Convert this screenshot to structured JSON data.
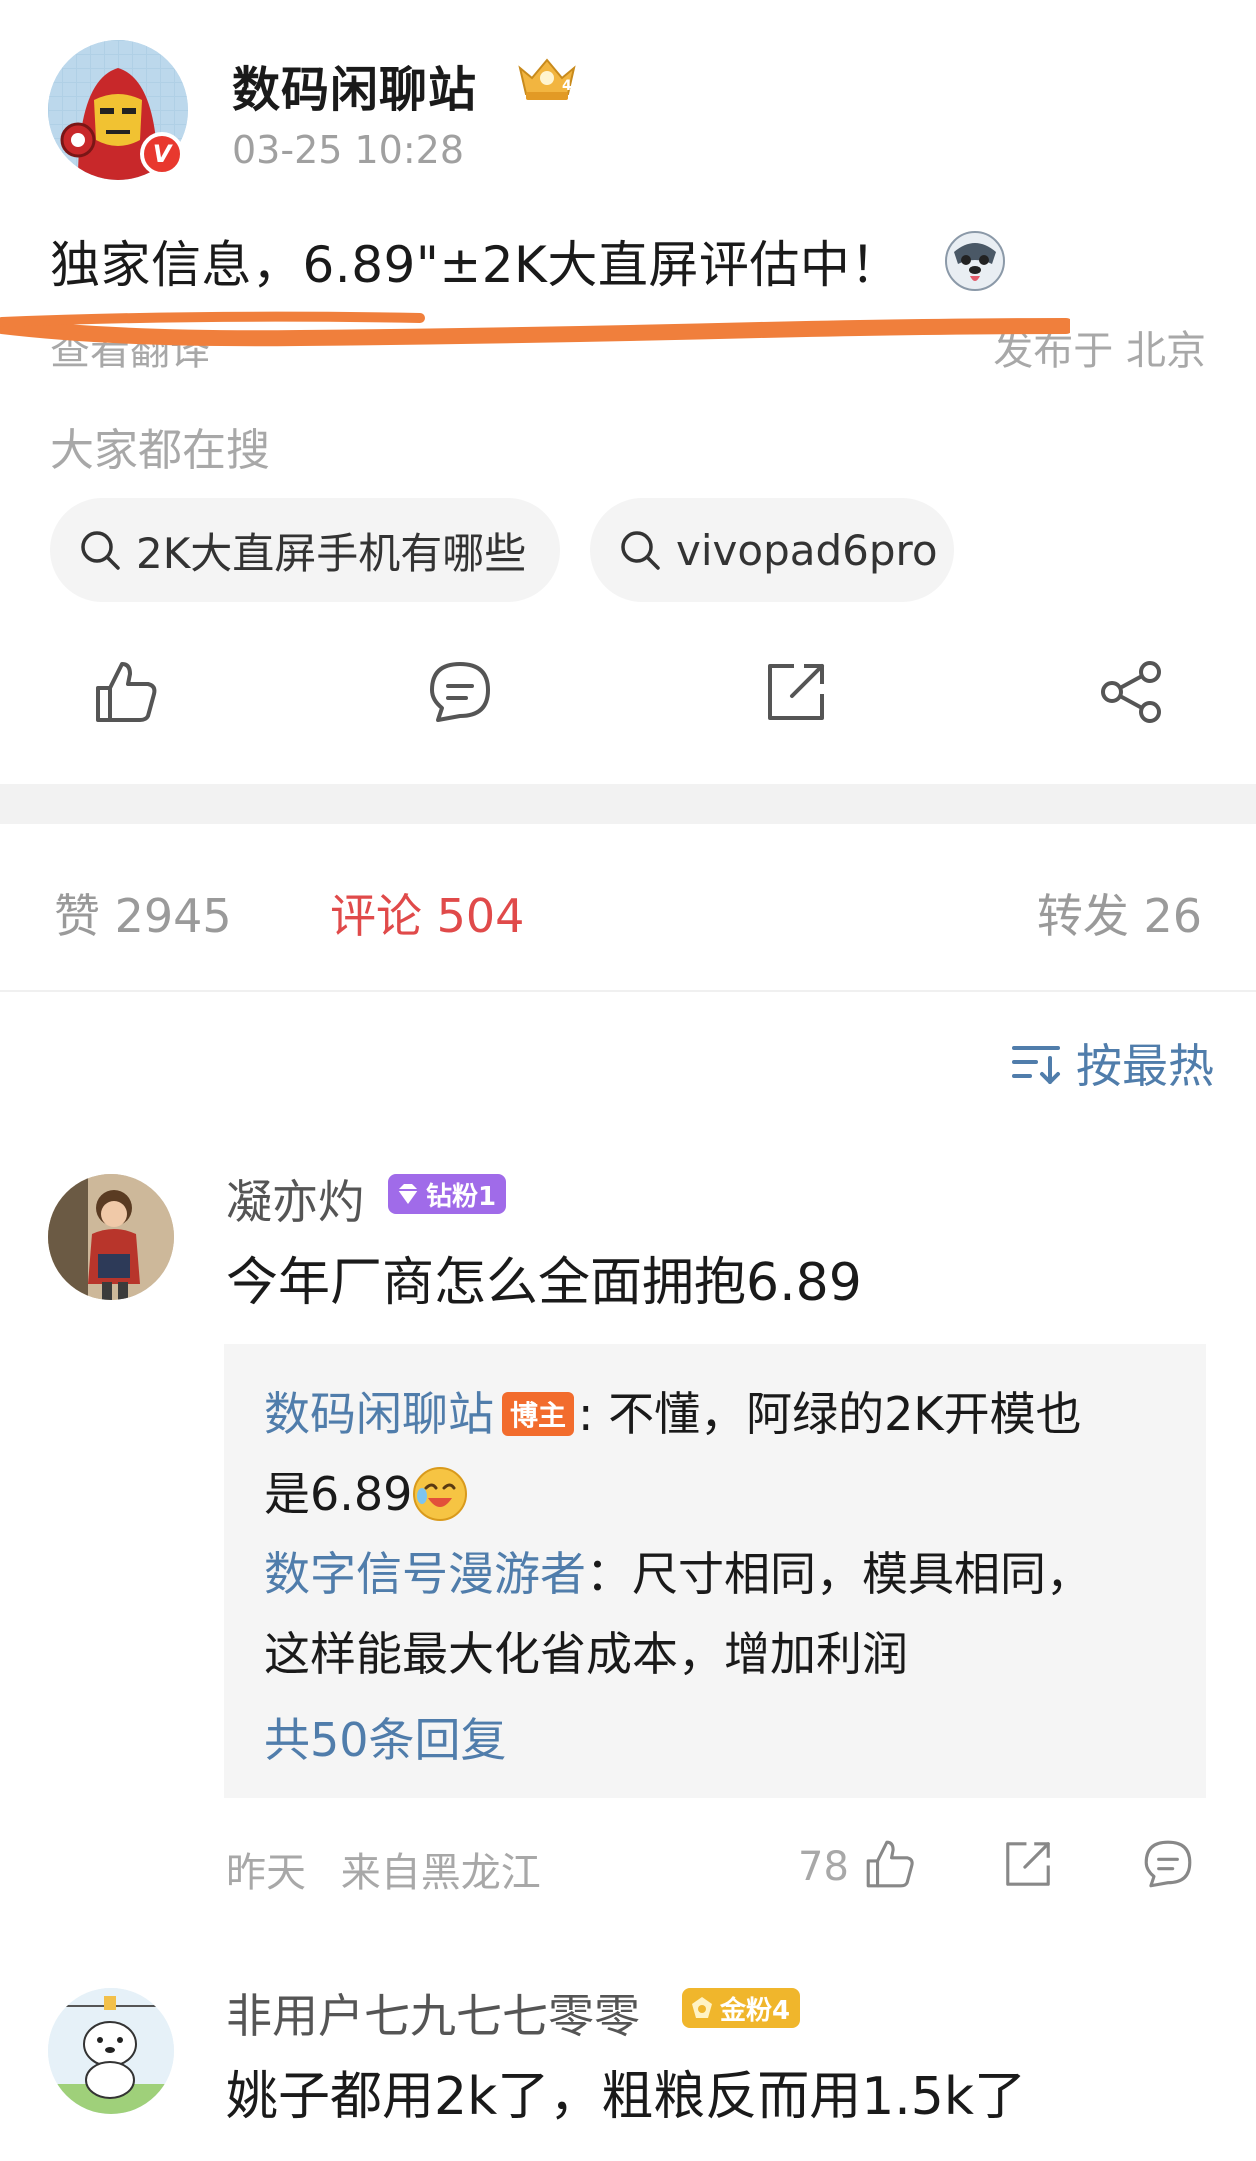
{
  "post": {
    "author_name": "数码闲聊站",
    "time": "03-25 10:28",
    "text": "独家信息，6.89\"±2K大直屏评估中！",
    "translate_label": "查看翻译",
    "location": "发布于 北京",
    "verified_mark": "V",
    "crown_level": "4"
  },
  "search": {
    "label": "大家都在搜",
    "chips": [
      "2K大直屏手机有哪些",
      "vivopad6pro"
    ]
  },
  "stats": {
    "likes": "赞 2945",
    "comments": "评论 504",
    "reposts": "转发 26"
  },
  "sort": {
    "label": "按最热"
  },
  "comments": [
    {
      "name": "凝亦灼",
      "badge": "钻粉1",
      "text": "今年厂商怎么全面拥抱6.89",
      "replies": [
        {
          "user": "数码闲聊站",
          "tag": "博主",
          "line1": ": 不懂，阿绿的2K开模也",
          "line2": "是6.89"
        },
        {
          "user": "数字信号漫游者",
          "line1": "：尺寸相同，模具相同，",
          "line2": "这样能最大化省成本，增加利润"
        }
      ],
      "more_replies": "共50条回复",
      "time": "昨天",
      "origin": "来自黑龙江",
      "like_count": "78"
    },
    {
      "name": "非用户七九七七零零",
      "badge": "金粉4",
      "text": "姚子都用2k了，粗粮反而用1.5k了"
    }
  ],
  "colors": {
    "link_blue": "#507dab",
    "comment_red": "#e04a4a",
    "highlight_orange": "#f07f3c",
    "diamond_fan": "#a06be9",
    "gold_fan": "#f0b62c"
  }
}
